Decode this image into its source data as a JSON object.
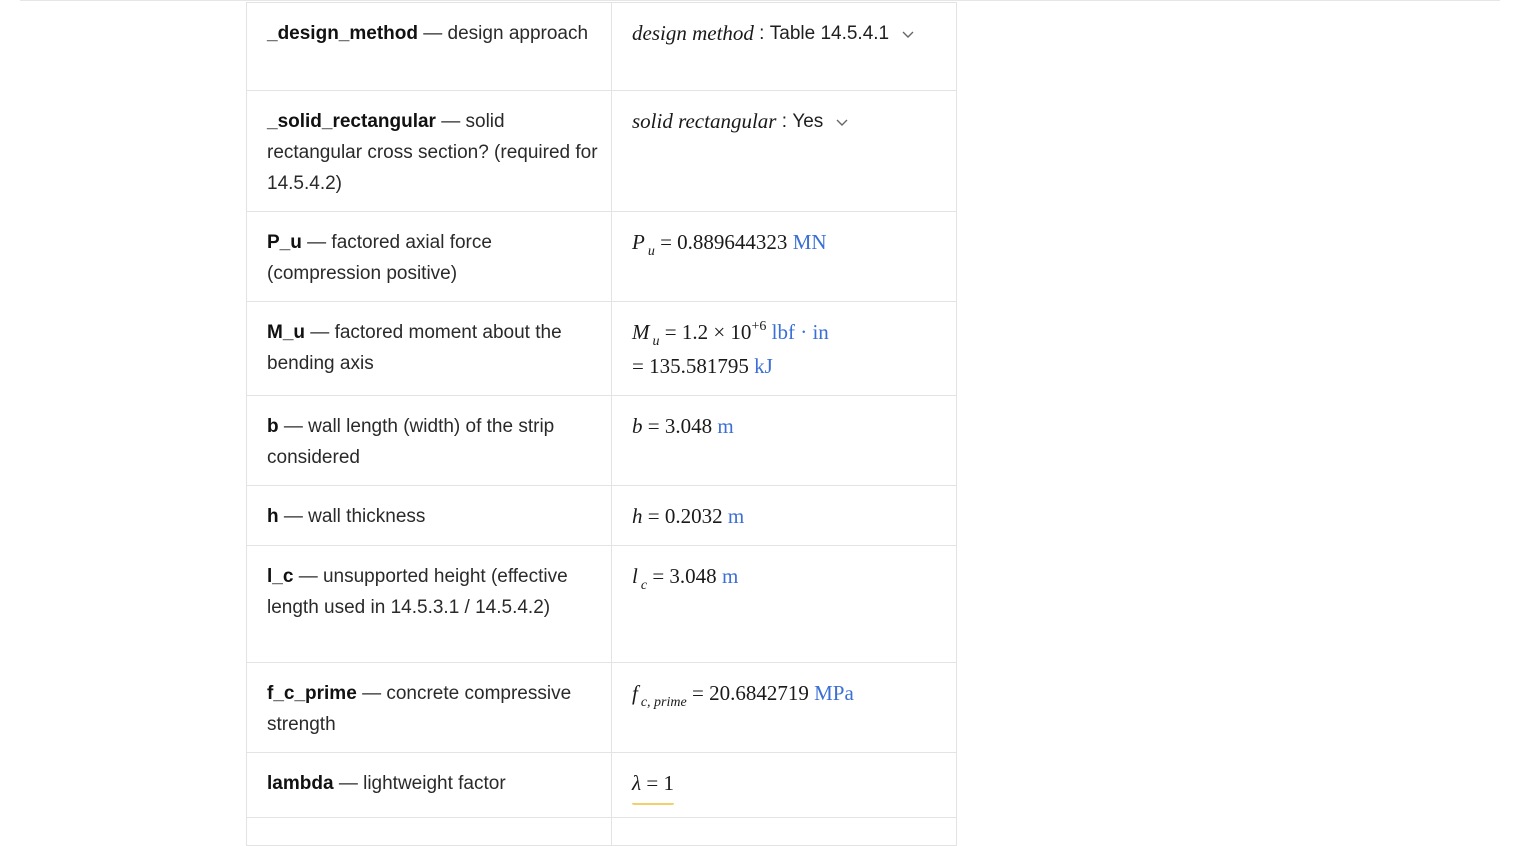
{
  "rows": [
    {
      "param": "_design_method",
      "desc": "design approach",
      "var": "design method",
      "value": "Table 14.5.4.1"
    },
    {
      "param": "_solid_rectangular",
      "desc": "solid rectangular cross section? (required for 14.5.4.2)",
      "var": "solid rectangular",
      "value": "Yes"
    },
    {
      "param": "P_u",
      "desc": "factored axial force (compression positive)",
      "sym": "P",
      "sub": "u",
      "value": "0.889644323",
      "unit": "MN"
    },
    {
      "param": "M_u",
      "desc": "factored moment about the bending axis",
      "sym": "M",
      "sub": "u",
      "value": "1.2 × 10",
      "exp": "+6",
      "unit": "lbf · in",
      "value2": "135.581795",
      "unit2": "kJ"
    },
    {
      "param": "b",
      "desc": "wall length (width) of the strip considered",
      "sym": "b",
      "value": "3.048",
      "unit": "m"
    },
    {
      "param": "h",
      "desc": "wall thickness",
      "sym": "h",
      "value": "0.2032",
      "unit": "m"
    },
    {
      "param": "l_c",
      "desc": "unsupported height (effective length used in 14.5.3.1 / 14.5.4.2)",
      "sym": "l",
      "sub": "c",
      "value": "3.048",
      "unit": "m"
    },
    {
      "param": "f_c_prime",
      "desc": "concrete compressive strength",
      "sym": "f",
      "sub": "c, prime",
      "value": "20.6842719",
      "unit": "MPa"
    },
    {
      "param": "lambda",
      "desc": "lightweight factor",
      "sym": "λ",
      "value": "1"
    }
  ],
  "separator": "—",
  "icons": {
    "dropdown": "chevron-down-icon"
  },
  "colors": {
    "unit": "#3b6fd6",
    "border": "#e3e3e3",
    "highlight": "#f2d16b"
  }
}
